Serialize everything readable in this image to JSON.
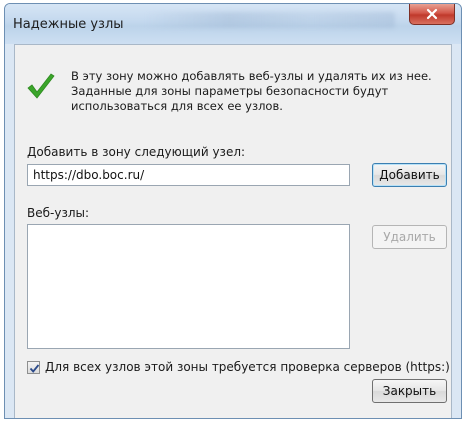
{
  "window": {
    "title": "Надежные узлы"
  },
  "info": {
    "icon": "checkmark-icon",
    "text": "В эту зону можно добавлять веб-узлы и удалять их из нее.\nЗаданные для зоны параметры безопасности будут\nиспользоваться для всех ее узлов."
  },
  "add_site": {
    "label": "Добавить в зону следующий узел:",
    "value": "https://dbo.boc.ru/",
    "button": "Добавить"
  },
  "sites": {
    "label": "Веб-узлы:",
    "items": [],
    "remove_button": "Удалить"
  },
  "https_check": {
    "label": "Для всех узлов этой зоны требуется проверка серверов (https:)",
    "checked": true
  },
  "close_button": "Закрыть",
  "colors": {
    "accent": "#3c7fb1",
    "check_green": "#3aa52a",
    "close_red": "#c0392b"
  }
}
